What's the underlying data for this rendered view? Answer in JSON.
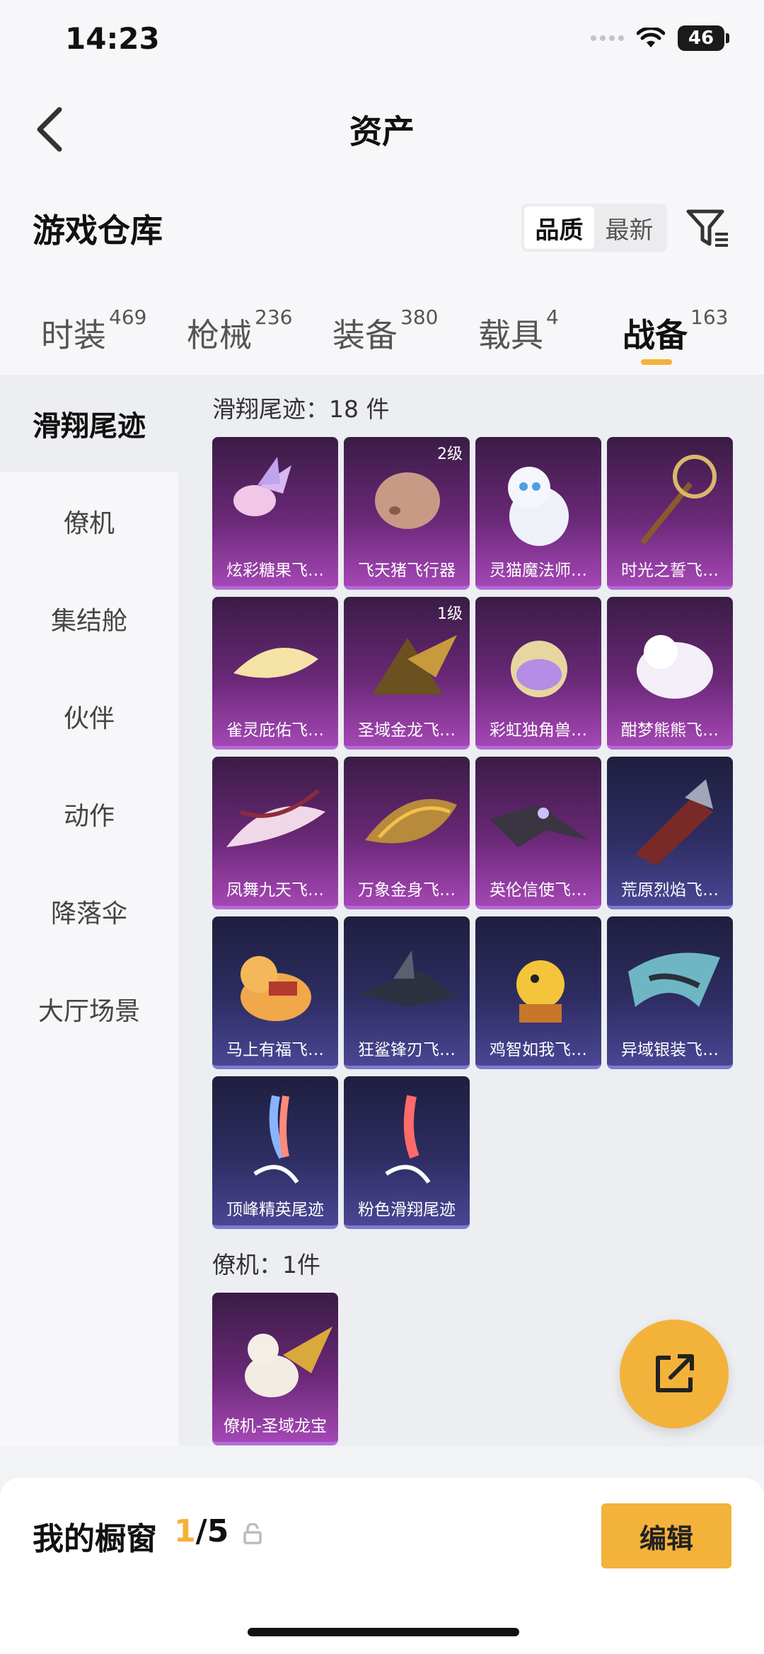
{
  "status_bar": {
    "time": "14:23",
    "battery": "46"
  },
  "header": {
    "title": "资产"
  },
  "section": {
    "title": "游戏仓库",
    "sort_options": [
      "品质",
      "最新"
    ],
    "sort_selected": "品质"
  },
  "tabs": [
    {
      "label": "时装",
      "count": "469"
    },
    {
      "label": "枪械",
      "count": "236"
    },
    {
      "label": "装备",
      "count": "380"
    },
    {
      "label": "载具",
      "count": "4"
    },
    {
      "label": "战备",
      "count": "163",
      "active": true
    }
  ],
  "sidebar": {
    "items": [
      "滑翔尾迹",
      "僚机",
      "集结舱",
      "伙伴",
      "动作",
      "降落伞",
      "大厅场景"
    ],
    "active": "滑翔尾迹"
  },
  "groups": [
    {
      "title": "滑翔尾迹：18 件",
      "items": [
        {
          "name": "炫彩糖果飞…",
          "theme": "purple"
        },
        {
          "name": "飞天猪飞行器",
          "theme": "purple",
          "level": "2级"
        },
        {
          "name": "灵猫魔法师…",
          "theme": "purple"
        },
        {
          "name": "时光之誓飞…",
          "theme": "purple"
        },
        {
          "name": "雀灵庇佑飞…",
          "theme": "purple"
        },
        {
          "name": "圣域金龙飞…",
          "theme": "purple",
          "level": "1级"
        },
        {
          "name": "彩虹独角兽…",
          "theme": "purple"
        },
        {
          "name": "酣梦熊熊飞…",
          "theme": "purple"
        },
        {
          "name": "凤舞九天飞…",
          "theme": "purple"
        },
        {
          "name": "万象金身飞…",
          "theme": "purple"
        },
        {
          "name": "英伦信使飞…",
          "theme": "purple"
        },
        {
          "name": "荒原烈焰飞…",
          "theme": "blue"
        },
        {
          "name": "马上有福飞…",
          "theme": "blue"
        },
        {
          "name": "狂鲨锋刃飞…",
          "theme": "blue"
        },
        {
          "name": "鸡智如我飞…",
          "theme": "blue"
        },
        {
          "name": "异域银装飞…",
          "theme": "blue"
        },
        {
          "name": "顶峰精英尾迹",
          "theme": "blue"
        },
        {
          "name": "粉色滑翔尾迹",
          "theme": "blue"
        }
      ]
    },
    {
      "title": "僚机：1件",
      "items": [
        {
          "name": "僚机-圣域龙宝",
          "theme": "purple"
        }
      ]
    }
  ],
  "showcase": {
    "label": "我的橱窗",
    "current": "1",
    "total": "/5",
    "edit_label": "编辑"
  },
  "colors": {
    "accent": "#f3b23a",
    "purple_card": "#6a2877",
    "blue_card": "#2e2d62"
  },
  "icons": [
    "back-icon",
    "filter-icon",
    "lock-icon",
    "share-icon",
    "wifi-icon",
    "signal-icon"
  ]
}
